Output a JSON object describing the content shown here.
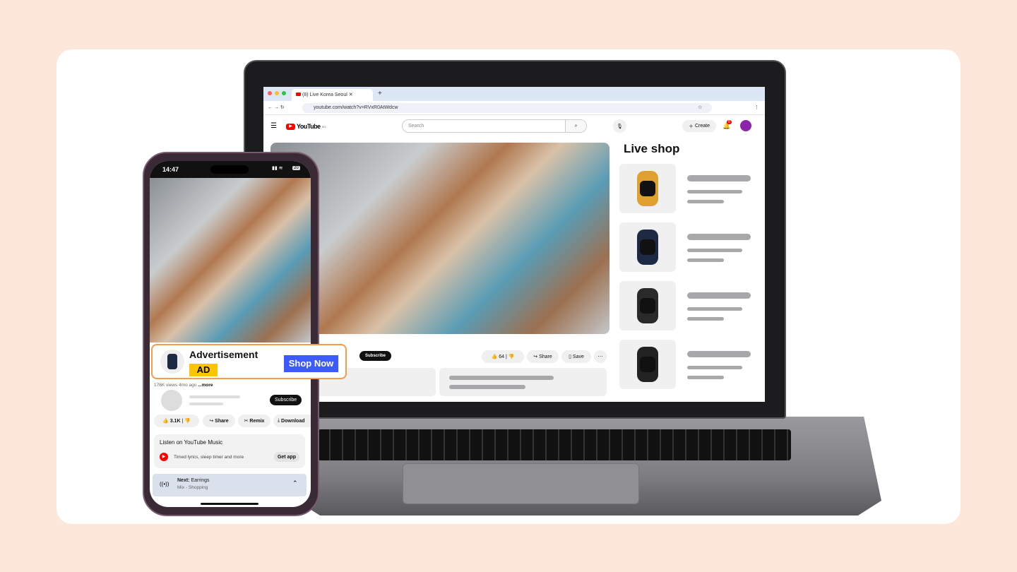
{
  "browser": {
    "tab_title": "(8) Live Korea Seoul",
    "new_tab": "+",
    "url": "youtube.com/watch?v=RVxR0AtWdcw"
  },
  "youtube": {
    "logo": "YouTube",
    "logo_sup": "SG",
    "search_placeholder": "Search",
    "create": "Create",
    "notif_count": "8"
  },
  "laptop_video": {
    "subscribe": "Subscribe",
    "likes": "64",
    "share": "Share",
    "save": "Save",
    "more": "⋯"
  },
  "live_shop": {
    "title": "Live shop",
    "products": [
      {
        "name": "orange-fitness-band",
        "color": "#e0a030"
      },
      {
        "name": "navy-smartwatch",
        "color": "#1e2a44"
      },
      {
        "name": "black-sport-watch",
        "color": "#2a2a2a"
      },
      {
        "name": "black-fitness-band",
        "color": "#222"
      }
    ]
  },
  "phone": {
    "time": "14:47",
    "battery": "20",
    "ad": {
      "title": "Advertisement",
      "badge": "AD",
      "cta": "Shop Now",
      "accent": "#3d5afe",
      "badge_color": "#ffc400",
      "border_color": "#f79a4a"
    },
    "meta": "176K views  4mo ago",
    "more": "...more",
    "subscribe": "Subscribe",
    "likes": "3.1K",
    "share": "Share",
    "remix": "Remix",
    "download": "Download",
    "music": {
      "title": "Listen on YouTube Music",
      "desc": "Timed lyrics, sleep timer and more",
      "cta": "Get app"
    },
    "next": {
      "label": "Next:",
      "title": "Earrings",
      "sub": "Mix - Shopping"
    }
  }
}
